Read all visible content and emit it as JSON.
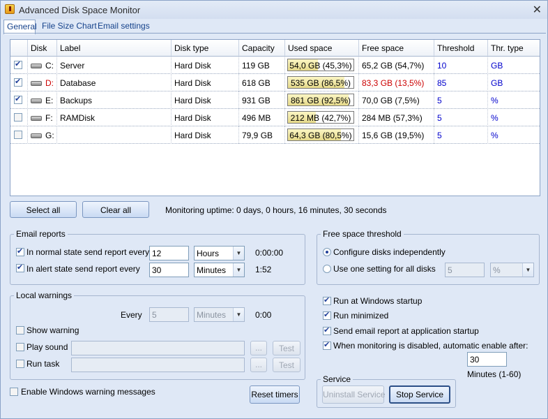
{
  "window": {
    "title": "Advanced Disk Space Monitor",
    "close_glyph": "✕"
  },
  "tabs": [
    {
      "label": "General",
      "active": true
    },
    {
      "label": "File Size Chart",
      "active": false
    },
    {
      "label": "Email settings",
      "active": false
    }
  ],
  "grid": {
    "headers": [
      "Disk",
      "Label",
      "Disk type",
      "Capacity",
      "Used space",
      "Free space",
      "Threshold",
      "Thr. type"
    ],
    "rows": [
      {
        "checked": true,
        "disk": "C:",
        "label": "Server",
        "type": "Hard Disk",
        "capacity": "119 GB",
        "used": "54,0 GB (45,3%)",
        "used_pct": 45.3,
        "free": "65,2 GB (54,7%)",
        "threshold": "10",
        "thr_type": "GB",
        "alert": false
      },
      {
        "checked": true,
        "disk": "D:",
        "label": "Database",
        "type": "Hard Disk",
        "capacity": "618 GB",
        "used": "535 GB (86,5%)",
        "used_pct": 86.5,
        "free": "83,3 GB (13,5%)",
        "threshold": "85",
        "thr_type": "GB",
        "alert": true
      },
      {
        "checked": true,
        "disk": "E:",
        "label": "Backups",
        "type": "Hard Disk",
        "capacity": "931 GB",
        "used": "861 GB (92,5%)",
        "used_pct": 92.5,
        "free": "70,0 GB (7,5%)",
        "threshold": "5",
        "thr_type": "%",
        "alert": false
      },
      {
        "checked": false,
        "disk": "F:",
        "label": "RAMDisk",
        "type": "Hard Disk",
        "capacity": "496 MB",
        "used": "212 MB (42,7%)",
        "used_pct": 42.7,
        "free": "284 MB (57,3%)",
        "threshold": "5",
        "thr_type": "%",
        "alert": false
      },
      {
        "checked": false,
        "disk": "G:",
        "label": "",
        "type": "Hard Disk",
        "capacity": "79,9 GB",
        "used": "64,3 GB (80,5%)",
        "used_pct": 80.5,
        "free": "15,6 GB (19,5%)",
        "threshold": "5",
        "thr_type": "%",
        "alert": false
      }
    ]
  },
  "buttons": {
    "select_all": "Select all",
    "clear_all": "Clear all",
    "reset_timers": "Reset timers",
    "uninstall_service": "Uninstall Service",
    "stop_service": "Stop Service",
    "browse": "...",
    "test": "Test"
  },
  "uptime": "Monitoring uptime: 0 days, 0 hours, 16 minutes, 30 seconds",
  "email_reports": {
    "title": "Email reports",
    "normal_label": "In normal state send report every",
    "normal_checked": true,
    "normal_value": "12",
    "normal_unit": "Hours",
    "normal_countdown": "0:00:00",
    "alert_label": "In alert state send report every",
    "alert_checked": true,
    "alert_value": "30",
    "alert_unit": "Minutes",
    "alert_countdown": "1:52"
  },
  "free_space_threshold": {
    "title": "Free space threshold",
    "option_independent": "Configure disks independently",
    "option_single": "Use one setting for all disks",
    "selected": "independent",
    "value": "5",
    "unit": "%"
  },
  "local_warnings": {
    "title": "Local warnings",
    "every_label": "Every",
    "every_value": "5",
    "every_unit": "Minutes",
    "countdown": "0:00",
    "show_warning": "Show warning",
    "play_sound": "Play sound",
    "run_task": "Run task"
  },
  "enable_windows_warnings": "Enable Windows warning messages",
  "options": {
    "run_at_startup": "Run at Windows startup",
    "run_minimized": "Run minimized",
    "send_report_startup": "Send email report at application startup",
    "auto_enable": "When monitoring is disabled, automatic enable after:",
    "auto_enable_value": "30",
    "auto_enable_hint": "Minutes (1-60)"
  },
  "service": {
    "title": "Service"
  }
}
